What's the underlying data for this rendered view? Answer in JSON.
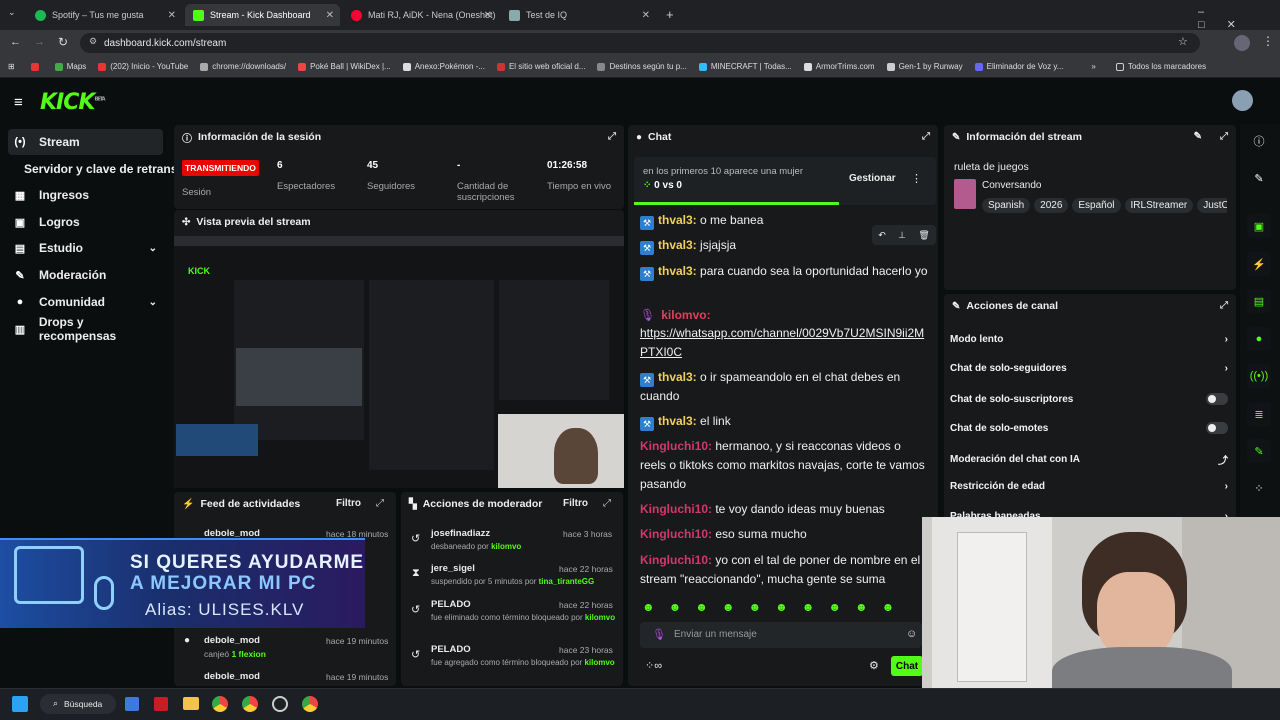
{
  "browser": {
    "tabs": [
      {
        "label": "Spotify – Tus me gusta",
        "color": "#1db954"
      },
      {
        "label": "Stream - Kick Dashboard",
        "color": "#53fc18"
      },
      {
        "label": "Mati RJ, AiDK - Nena (Oneshot)",
        "color": "#ff0033"
      },
      {
        "label": "Test de IQ",
        "color": "#8aa"
      }
    ],
    "url": "dashboard.kick.com/stream",
    "bookmarks": [
      "Maps",
      "(202) Inicio - YouTube",
      "chrome://downloads/",
      "Poké Ball | WikiDex |...",
      "Anexo:Pokémon -...",
      "El sitio web oficial d...",
      "Destinos según tu p...",
      "MINECRAFT | Todas...",
      "ArmorTrims.com",
      "Gen-1 by Runway",
      "Eliminador de Voz y..."
    ],
    "all_bookmarks": "Todos los marcadores"
  },
  "app": {
    "logo": "KICK",
    "logo_sup": "BETA"
  },
  "sidebar": {
    "items": [
      {
        "label": "Stream",
        "icon": "(•)"
      },
      {
        "label": "Servidor y clave de retransmisión",
        "icon": ""
      },
      {
        "label": "Ingresos",
        "icon": "▦"
      },
      {
        "label": "Logros",
        "icon": "▣"
      },
      {
        "label": "Estudio",
        "icon": "▤"
      },
      {
        "label": "Moderación",
        "icon": "✎"
      },
      {
        "label": "Comunidad",
        "icon": "●"
      },
      {
        "label": "Drops y recompensas",
        "icon": "▥"
      }
    ]
  },
  "session": {
    "title": "Información de la sesión",
    "status": "TRANSMITIENDO",
    "status_label": "Sesión",
    "stats": [
      {
        "value": "6",
        "label": "Espectadores"
      },
      {
        "value": "45",
        "label": "Seguidores"
      },
      {
        "value": "-",
        "label": "Cantidad de suscripciones"
      },
      {
        "value": "01:26:58",
        "label": "Tiempo en vivo"
      }
    ]
  },
  "preview": {
    "title": "Vista previa del stream"
  },
  "feed": {
    "title": "Feed de actividades",
    "filter": "Filtro",
    "items": [
      {
        "user": "debole_mod",
        "time": "hace 18 minutos",
        "detail": ""
      },
      {
        "user": "debole_mod",
        "time": "hace 19 minutos",
        "detail": "canjeó",
        "reward": "1 flexion"
      },
      {
        "user": "debole_mod",
        "time": "hace 19 minutos",
        "detail": ""
      }
    ]
  },
  "mod": {
    "title": "Acciones de moderador",
    "filter": "Filtro",
    "items": [
      {
        "user": "josefinadiazz",
        "time": "hace 3 horas",
        "detail": "desbaneado por",
        "by": "kilomvo"
      },
      {
        "user": "jere_sigel",
        "time": "hace 22 horas",
        "detail": "suspendido por 5 minutos por",
        "by": "tina_tiranteGG"
      },
      {
        "user": "PELADO",
        "time": "hace 22 horas",
        "detail": "fue eliminado como término bloqueado por",
        "by": "kilomvo"
      },
      {
        "user": "PELADO",
        "time": "hace 23 horas",
        "detail": "fue agregado como término bloqueado por",
        "by": "kilomvo"
      }
    ]
  },
  "chat": {
    "title": "Chat",
    "poll_text": "en los primeros 10 aparece una mujer",
    "poll_score": "0 vs 0",
    "manage": "Gestionar",
    "messages": [
      {
        "user": "thval3:",
        "text": " o me banea"
      },
      {
        "user": "thval3:",
        "text": " jsjajsja"
      },
      {
        "user": "thval3:",
        "text": " para cuando sea la oportunidad hacerlo yo"
      },
      {
        "user": "kilomvo:",
        "text": ""
      },
      {
        "user": "",
        "text": "https://whatsapp.com/channel/0029Vb7U2MSIN9ii2MPTXI0C"
      },
      {
        "user": "thval3:",
        "text": " o ir spameandolo en el chat debes en cuando"
      },
      {
        "user": "thval3:",
        "text": " el link"
      },
      {
        "user": "Kingluchi10:",
        "text": " hermanoo, y si reacconas videos o reels o tiktoks como markitos navajas, corte te vamos pasando"
      },
      {
        "user": "Kingluchi10:",
        "text": " te voy dando ideas muy buenas"
      },
      {
        "user": "Kingluchi10:",
        "text": " eso suma mucho"
      },
      {
        "user": "Kingluchi10:",
        "text": " yo con el tal de poner de nombre en el stream \"reaccionando\", mucha gente se suma"
      }
    ],
    "placeholder": "Enviar un mensaje",
    "send": "Chat"
  },
  "stream_info": {
    "title": "Información del stream",
    "stream_title": "ruleta de juegos",
    "category": "Conversando",
    "tags": [
      "Spanish",
      "2026",
      "Español",
      "IRLStreamer",
      "JustC"
    ]
  },
  "channel_actions": {
    "title": "Acciones de canal",
    "items": [
      {
        "label": "Modo lento",
        "control": "arrow"
      },
      {
        "label": "Chat de solo-seguidores",
        "control": "arrow"
      },
      {
        "label": "Chat de solo-suscriptores",
        "control": "toggle"
      },
      {
        "label": "Chat de solo-emotes",
        "control": "toggle"
      },
      {
        "label": "Moderación del chat con IA",
        "control": "link"
      },
      {
        "label": "Restricción de edad",
        "control": "arrow"
      },
      {
        "label": "Palabras baneadas",
        "control": "arrow"
      }
    ]
  },
  "overlay": {
    "line1": "SI QUERES AYUDARME",
    "line2": "A MEJORAR MI PC",
    "line3": "Alias: ULISES.KLV"
  },
  "taskbar": {
    "search": "Búsqueda"
  },
  "colors": {
    "accent": "#53fc18",
    "live": "#eb0400",
    "panel": "#17191b"
  }
}
